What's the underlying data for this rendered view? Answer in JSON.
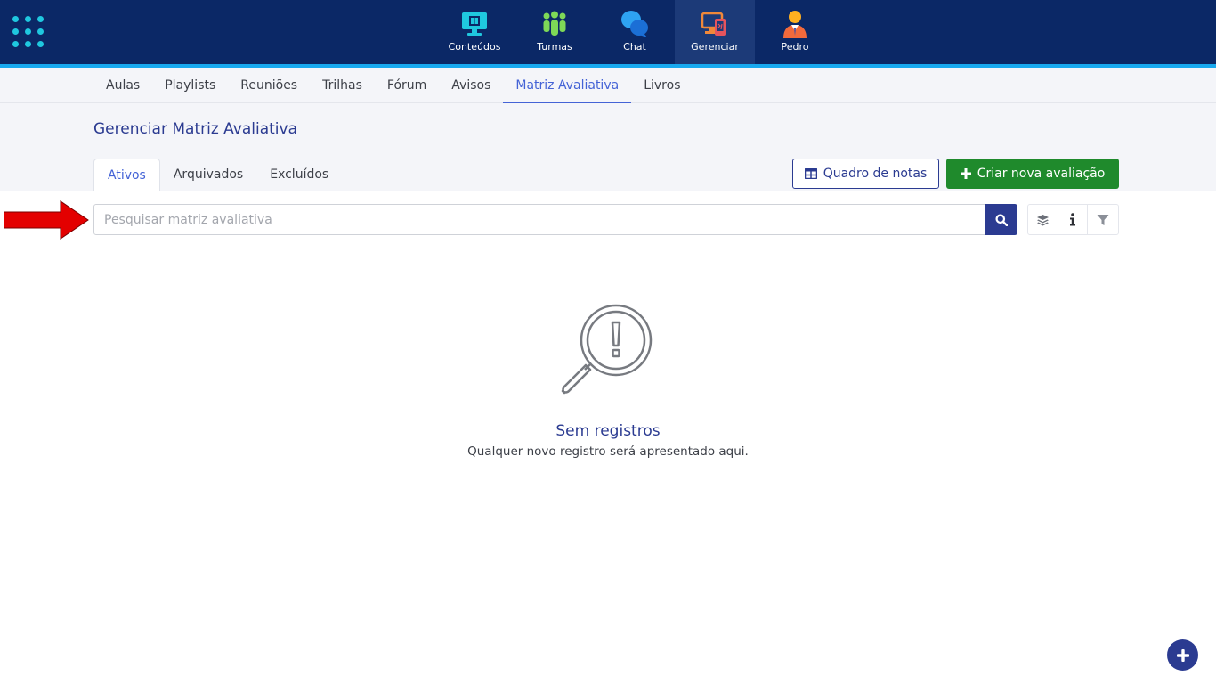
{
  "topnav": {
    "items": [
      {
        "label": "Conteúdos",
        "icon": "monitor-book-icon"
      },
      {
        "label": "Turmas",
        "icon": "group-people-icon"
      },
      {
        "label": "Chat",
        "icon": "chat-bubbles-icon"
      },
      {
        "label": "Gerenciar",
        "icon": "manage-devices-icon",
        "active": true
      },
      {
        "label": "Pedro",
        "icon": "user-avatar-icon"
      }
    ]
  },
  "subnav": {
    "items": [
      "Aulas",
      "Playlists",
      "Reuniões",
      "Trilhas",
      "Fórum",
      "Avisos",
      "Matriz Avaliativa",
      "Livros"
    ],
    "active": "Matriz Avaliativa"
  },
  "page": {
    "title": "Gerenciar Matriz Avaliativa"
  },
  "tabs": {
    "items": [
      "Ativos",
      "Arquivados",
      "Excluídos"
    ],
    "active": "Ativos"
  },
  "actions": {
    "quadro_label": "Quadro de notas",
    "criar_label": "Criar nova avaliação"
  },
  "search": {
    "placeholder": "Pesquisar matriz avaliativa",
    "value": ""
  },
  "empty_state": {
    "title": "Sem registros",
    "subtitle": "Qualquer novo registro será apresentado aqui."
  },
  "colors": {
    "topbar": "#0b2866",
    "accent": "#2b3b91",
    "link_active": "#4463d6",
    "success": "#1f8a2c",
    "highlight_line": "#18a9ef",
    "annotation_arrow": "#e30000"
  }
}
